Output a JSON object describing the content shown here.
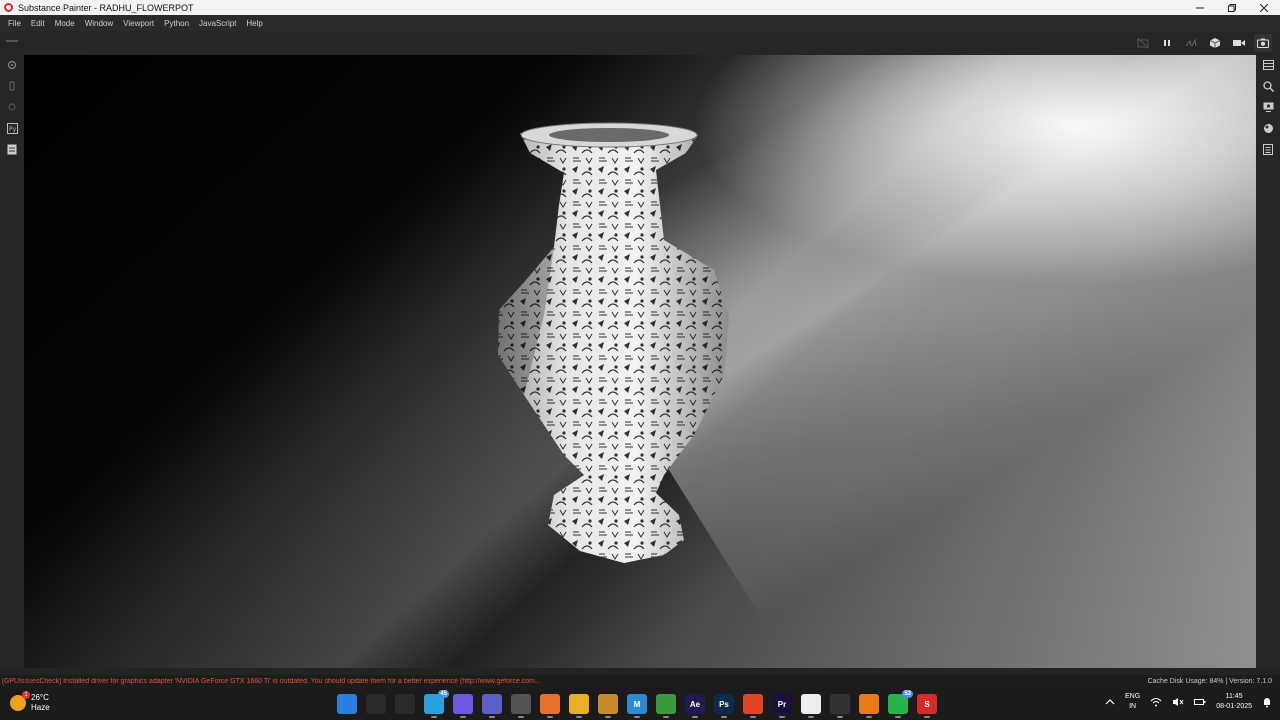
{
  "window": {
    "title": "Substance Painter - RADHU_FLOWERPOT",
    "controls": [
      "minimize-icon",
      "restore-icon",
      "close-icon"
    ]
  },
  "menu": [
    "File",
    "Edit",
    "Mode",
    "Window",
    "Viewport",
    "Python",
    "JavaScript",
    "Help"
  ],
  "toolbar_icons": [
    "camera-off-icon",
    "pause-icon",
    "split-view-icon",
    "cube-icon",
    "video-camera-icon",
    "screenshot-icon"
  ],
  "left_strip_icons": [
    "settings-icon",
    "brush-icon",
    "gear-icon",
    "python-icon",
    "script-icon"
  ],
  "right_strip_icons": [
    "layers-icon",
    "zoom-icon",
    "display-icon",
    "environment-icon",
    "properties-icon"
  ],
  "status": {
    "warning": "[GPUIssuesCheck] Installed driver for graphics adapter 'NVIDIA GeForce GTX 1660 Ti' is outdated. You should update them for a better experience (http://www.geforce.com...",
    "cache": "Cache Disk Usage:  84% | Version: 7.1.0"
  },
  "taskbar": {
    "weather": {
      "temp": "26°C",
      "condition": "Haze",
      "badge": "1"
    },
    "apps": [
      {
        "name": "windows-start",
        "label": "",
        "color": "#2b7de0"
      },
      {
        "name": "search",
        "label": "",
        "color": "#2a2a2a"
      },
      {
        "name": "task-view",
        "label": "",
        "color": "#2a2a2a"
      },
      {
        "name": "telegram",
        "label": "",
        "color": "#2aa0dc",
        "count": "45"
      },
      {
        "name": "copilot",
        "label": "",
        "color": "#6a5ae0"
      },
      {
        "name": "teams",
        "label": "",
        "color": "#5b5fc7"
      },
      {
        "name": "settings",
        "label": "",
        "color": "#555"
      },
      {
        "name": "firefox",
        "label": "",
        "color": "#e8702a"
      },
      {
        "name": "file-explorer",
        "label": "",
        "color": "#e8b02a"
      },
      {
        "name": "blender-like",
        "label": "",
        "color": "#c88a2a"
      },
      {
        "name": "m-app",
        "label": "M",
        "color": "#2c8bd0"
      },
      {
        "name": "chrome",
        "label": "",
        "color": "#3b9a3b"
      },
      {
        "name": "after-effects",
        "label": "Ae",
        "color": "#1d1b4f"
      },
      {
        "name": "photoshop",
        "label": "Ps",
        "color": "#0c2a4a"
      },
      {
        "name": "brave",
        "label": "",
        "color": "#e0452a"
      },
      {
        "name": "premiere",
        "label": "Pr",
        "color": "#1e0f3a"
      },
      {
        "name": "msi-app",
        "label": "",
        "color": "#eee"
      },
      {
        "name": "cube-app",
        "label": "",
        "color": "#333"
      },
      {
        "name": "blender",
        "label": "",
        "color": "#e87a1a"
      },
      {
        "name": "whatsapp",
        "label": "",
        "color": "#25b34a",
        "count": "53"
      },
      {
        "name": "substance-painter",
        "label": "S",
        "color": "#d52b2b"
      }
    ],
    "tray": {
      "lang_top": "ENG",
      "lang_bottom": "IN",
      "time": "11:45",
      "date": "08-01-2025"
    }
  }
}
